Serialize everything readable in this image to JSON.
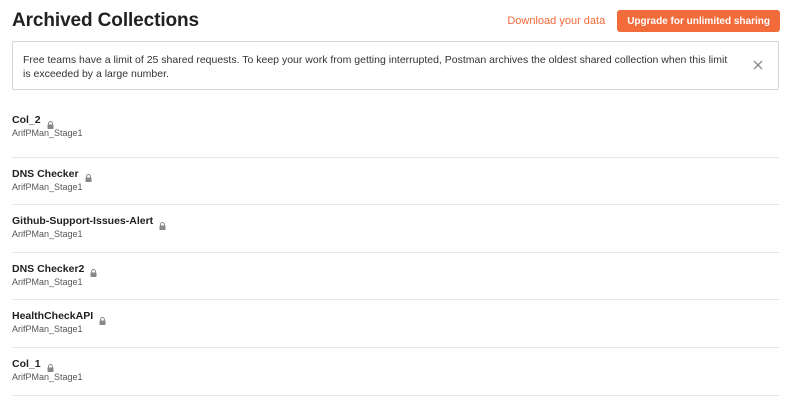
{
  "header": {
    "title": "Archived Collections",
    "download_label": "Download your data",
    "upgrade_label": "Upgrade for unlimited sharing"
  },
  "banner": {
    "message": "Free teams have a limit of 25 shared requests. To keep your work from getting interrupted, Postman archives the oldest shared collection when this limit is exceeded by a large number.",
    "close_icon": "close-icon"
  },
  "collections": [
    {
      "name": "Col_2",
      "owner": "ArifPMan_Stage1",
      "icon": "lock-icon"
    },
    {
      "name": "DNS Checker",
      "owner": "ArifPMan_Stage1",
      "icon": "lock-icon"
    },
    {
      "name": "Github-Support-Issues-Alert",
      "owner": "ArifPMan_Stage1",
      "icon": "lock-icon"
    },
    {
      "name": "DNS Checker2",
      "owner": "ArifPMan_Stage1",
      "icon": "lock-icon"
    },
    {
      "name": "HealthCheckAPI",
      "owner": "ArifPMan_Stage1",
      "icon": "lock-icon"
    },
    {
      "name": "Col_1",
      "owner": "ArifPMan_Stage1",
      "icon": "lock-icon"
    }
  ],
  "colors": {
    "accent": "#f26b3a",
    "text": "#212121",
    "muted": "#555555",
    "border": "#d4d4d4"
  }
}
